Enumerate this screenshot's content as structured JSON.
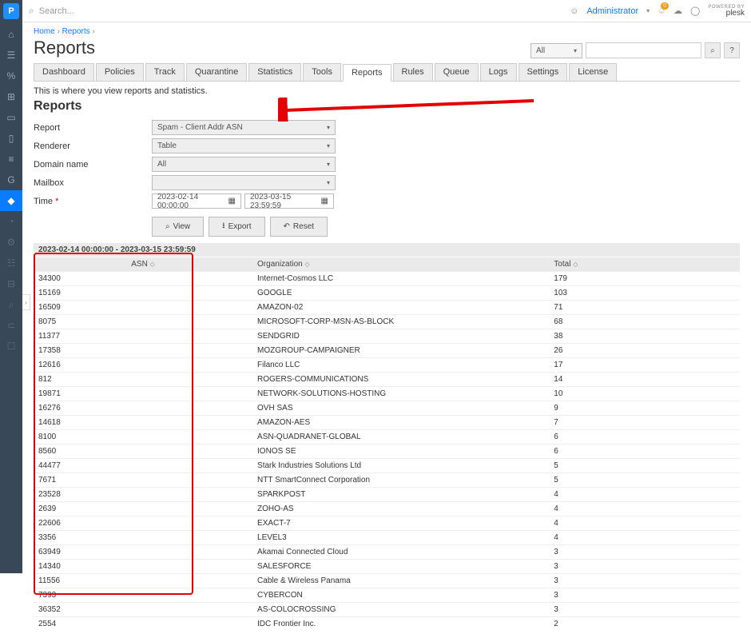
{
  "topbar": {
    "search_placeholder": "Search...",
    "admin_label": "Administrator",
    "notification_count": "0",
    "powered_by": "POWERED BY",
    "brand": "plesk"
  },
  "breadcrumb": {
    "home": "Home",
    "reports": "Reports"
  },
  "page": {
    "title": "Reports",
    "intro": "This is where you view reports and statistics.",
    "section_title": "Reports"
  },
  "right_filter": {
    "scope": "All"
  },
  "tabs": [
    {
      "label": "Dashboard"
    },
    {
      "label": "Policies"
    },
    {
      "label": "Track"
    },
    {
      "label": "Quarantine"
    },
    {
      "label": "Statistics"
    },
    {
      "label": "Tools"
    },
    {
      "label": "Reports",
      "active": true
    },
    {
      "label": "Rules"
    },
    {
      "label": "Queue"
    },
    {
      "label": "Logs"
    },
    {
      "label": "Settings"
    },
    {
      "label": "License"
    }
  ],
  "form": {
    "report_label": "Report",
    "report_value": "Spam - Client Addr ASN",
    "renderer_label": "Renderer",
    "renderer_value": "Table",
    "domain_label": "Domain name",
    "domain_value": "All",
    "mailbox_label": "Mailbox",
    "mailbox_value": "",
    "time_label": "Time",
    "time_from": "2023-02-14 00:00:00",
    "time_to": "2023-03-15 23:59:59"
  },
  "buttons": {
    "view": "View",
    "export": "Export",
    "reset": "Reset"
  },
  "table": {
    "range": "2023-02-14 00:00:00 - 2023-03-15 23:59:59",
    "col_asn": "ASN",
    "col_org": "Organization",
    "col_total": "Total",
    "rows": [
      {
        "asn": "34300",
        "org": "Internet-Cosmos LLC",
        "total": "179"
      },
      {
        "asn": "15169",
        "org": "GOOGLE",
        "total": "103"
      },
      {
        "asn": "16509",
        "org": "AMAZON-02",
        "total": "71"
      },
      {
        "asn": "8075",
        "org": "MICROSOFT-CORP-MSN-AS-BLOCK",
        "total": "68"
      },
      {
        "asn": "11377",
        "org": "SENDGRID",
        "total": "38"
      },
      {
        "asn": "17358",
        "org": "MOZGROUP-CAMPAIGNER",
        "total": "26"
      },
      {
        "asn": "12616",
        "org": "Filanco LLC",
        "total": "17"
      },
      {
        "asn": "812",
        "org": "ROGERS-COMMUNICATIONS",
        "total": "14"
      },
      {
        "asn": "19871",
        "org": "NETWORK-SOLUTIONS-HOSTING",
        "total": "10"
      },
      {
        "asn": "16276",
        "org": "OVH SAS",
        "total": "9"
      },
      {
        "asn": "14618",
        "org": "AMAZON-AES",
        "total": "7"
      },
      {
        "asn": "8100",
        "org": "ASN-QUADRANET-GLOBAL",
        "total": "6"
      },
      {
        "asn": "8560",
        "org": "IONOS SE",
        "total": "6"
      },
      {
        "asn": "44477",
        "org": "Stark Industries Solutions Ltd",
        "total": "5"
      },
      {
        "asn": "7671",
        "org": "NTT SmartConnect Corporation",
        "total": "5"
      },
      {
        "asn": "23528",
        "org": "SPARKPOST",
        "total": "4"
      },
      {
        "asn": "2639",
        "org": "ZOHO-AS",
        "total": "4"
      },
      {
        "asn": "22606",
        "org": "EXACT-7",
        "total": "4"
      },
      {
        "asn": "3356",
        "org": "LEVEL3",
        "total": "4"
      },
      {
        "asn": "63949",
        "org": "Akamai Connected Cloud",
        "total": "3"
      },
      {
        "asn": "14340",
        "org": "SALESFORCE",
        "total": "3"
      },
      {
        "asn": "11556",
        "org": "Cable & Wireless Panama",
        "total": "3"
      },
      {
        "asn": "7393",
        "org": "CYBERCON",
        "total": "3"
      },
      {
        "asn": "36352",
        "org": "AS-COLOCROSSING",
        "total": "3"
      },
      {
        "asn": "2554",
        "org": "IDC Frontier Inc.",
        "total": "2"
      }
    ]
  }
}
